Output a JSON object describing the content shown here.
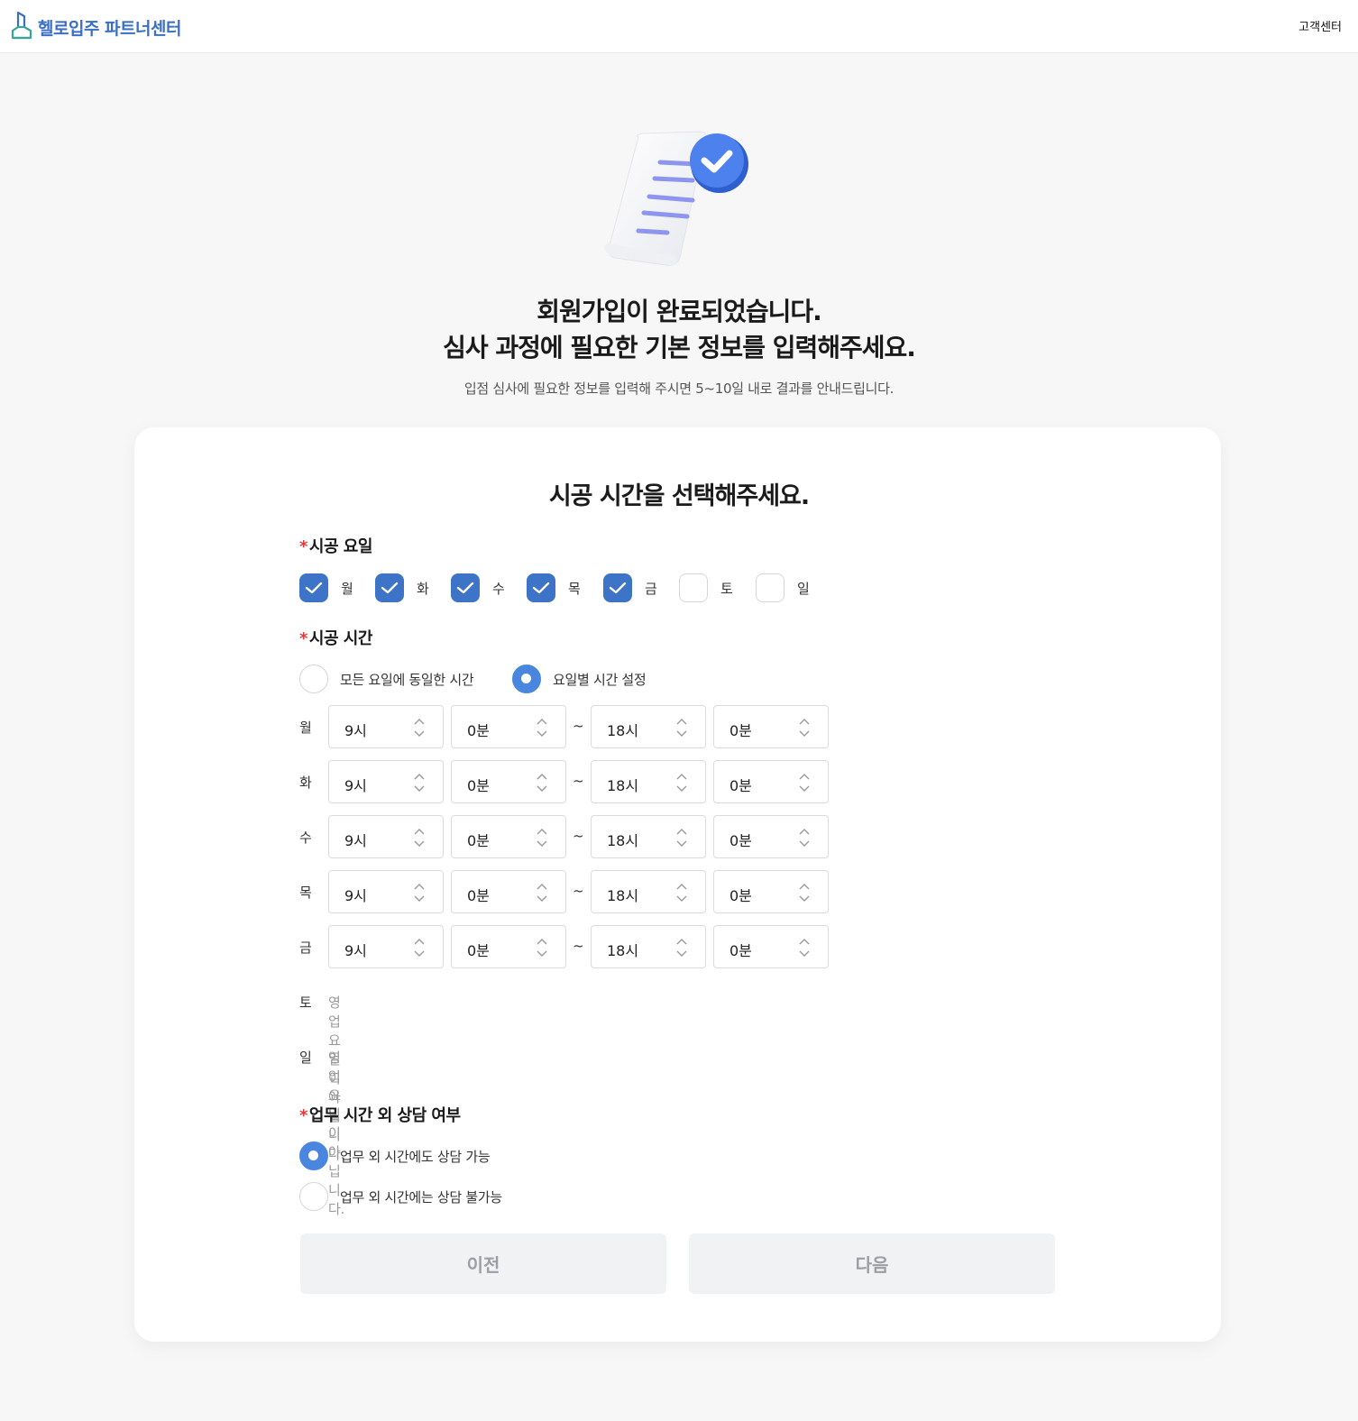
{
  "header": {
    "brand": "헬로입주 파트너센터",
    "help": "고객센터"
  },
  "hero": {
    "title_line1": "회원가입이 완료되었습니다.",
    "title_line2": "심사 과정에 필요한 기본 정보를 입력해주세요.",
    "subtitle": "입점 심사에 필요한 정보를 입력해 주시면 5~10일 내로 결과를 안내드립니다."
  },
  "form": {
    "title": "시공 시간을 선택해주세요.",
    "days_section": {
      "label": "시공 요일",
      "days": [
        {
          "label": "월",
          "checked": true
        },
        {
          "label": "화",
          "checked": true
        },
        {
          "label": "수",
          "checked": true
        },
        {
          "label": "목",
          "checked": true
        },
        {
          "label": "금",
          "checked": true
        },
        {
          "label": "토",
          "checked": false
        },
        {
          "label": "일",
          "checked": false
        }
      ]
    },
    "time_section": {
      "label": "시공 시간",
      "options": [
        {
          "label": "모든 요일에 동일한 시간",
          "selected": false
        },
        {
          "label": "요일별 시간 설정",
          "selected": true
        }
      ],
      "separator": "~",
      "rows": [
        {
          "day": "월",
          "start_hour": "9시",
          "start_min": "0분",
          "end_hour": "18시",
          "end_min": "0분"
        },
        {
          "day": "화",
          "start_hour": "9시",
          "start_min": "0분",
          "end_hour": "18시",
          "end_min": "0분"
        },
        {
          "day": "수",
          "start_hour": "9시",
          "start_min": "0분",
          "end_hour": "18시",
          "end_min": "0분"
        },
        {
          "day": "목",
          "start_hour": "9시",
          "start_min": "0분",
          "end_hour": "18시",
          "end_min": "0분"
        },
        {
          "day": "금",
          "start_hour": "9시",
          "start_min": "0분",
          "end_hour": "18시",
          "end_min": "0분"
        }
      ],
      "closed_rows": [
        {
          "day": "토",
          "text": "영업 요일이 아닙니다."
        },
        {
          "day": "일",
          "text": "영업 요일이 아닙니다."
        }
      ]
    },
    "consult_section": {
      "label": "업무 시간 외 상담 여부",
      "options": [
        {
          "label": "업무 외 시간에도 상담 가능",
          "selected": true
        },
        {
          "label": "업무 외 시간에는 상담 불가능",
          "selected": false
        }
      ]
    },
    "buttons": {
      "prev": "이전",
      "next": "다음"
    }
  },
  "colors": {
    "accent": "#3d74c8",
    "radio_accent": "#4a86e0",
    "required": "#e33b3b",
    "brand": "#3a6fc4"
  }
}
